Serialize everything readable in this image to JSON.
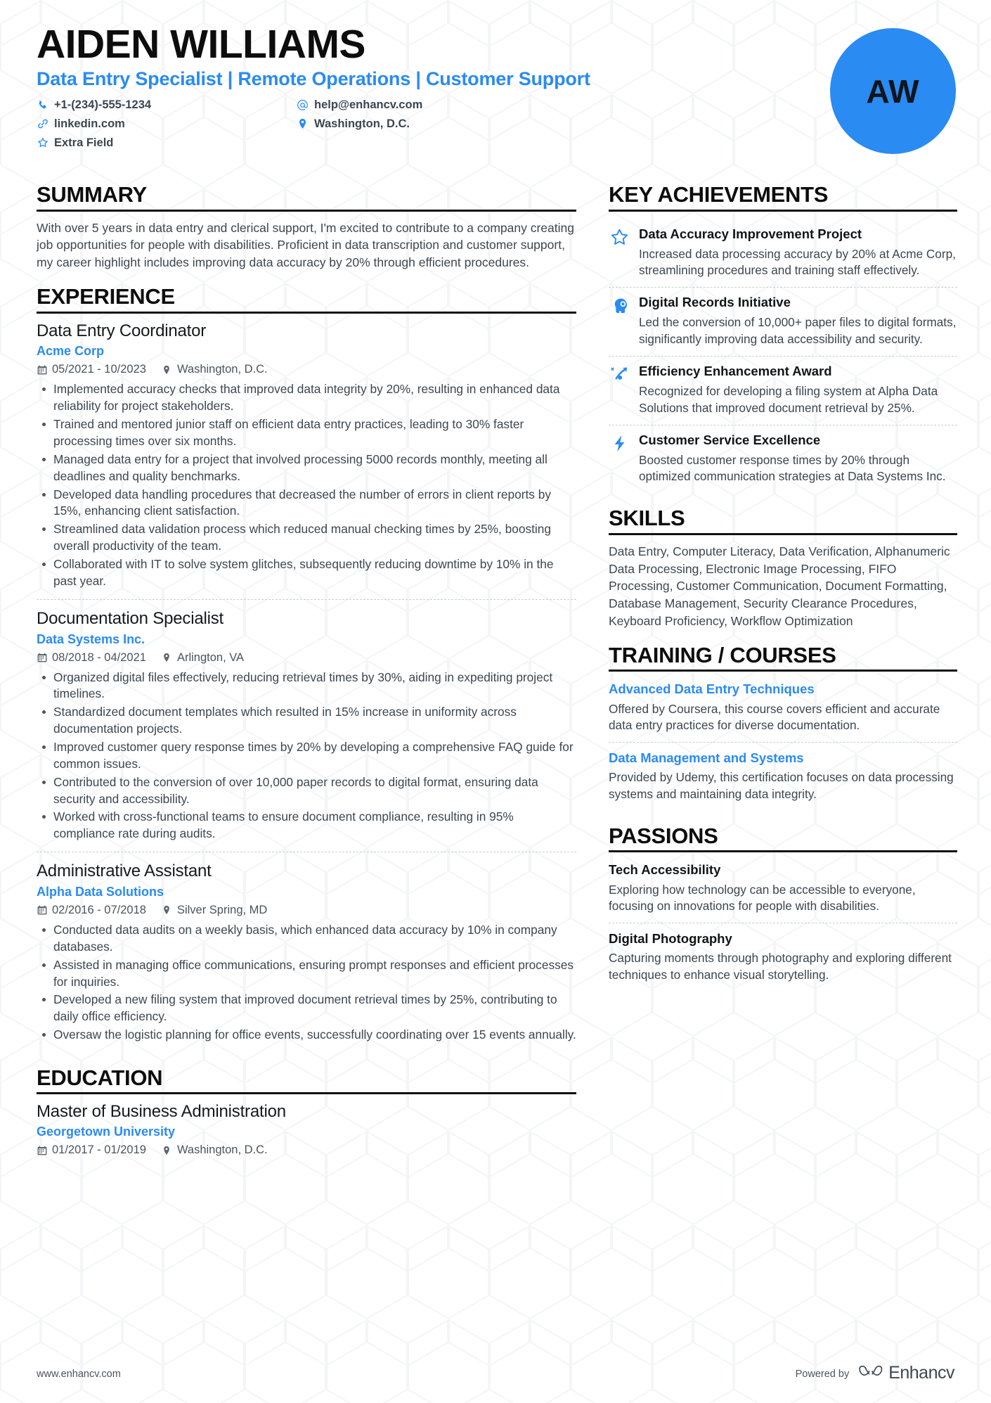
{
  "header": {
    "name": "AIDEN WILLIAMS",
    "headline": "Data Entry Specialist | Remote Operations | Customer Support",
    "avatar_initials": "AW",
    "accent_color": "#2a8bf2",
    "contacts": [
      {
        "icon": "phone-icon",
        "value": "+1-(234)-555-1234"
      },
      {
        "icon": "link-icon",
        "value": "linkedin.com"
      },
      {
        "icon": "star-icon",
        "value": "Extra Field"
      },
      {
        "icon": "at-icon",
        "value": "help@enhancv.com"
      },
      {
        "icon": "location-icon",
        "value": "Washington, D.C."
      }
    ]
  },
  "summary": {
    "title": "SUMMARY",
    "text": "With over 5 years in data entry and clerical support, I'm excited to contribute to a company creating job opportunities for people with disabilities. Proficient in data transcription and customer support, my career highlight includes improving data accuracy by 20% through efficient procedures."
  },
  "experience": {
    "title": "EXPERIENCE",
    "jobs": [
      {
        "role": "Data Entry Coordinator",
        "company": "Acme Corp",
        "dates": "05/2021 - 10/2023",
        "location": "Washington, D.C.",
        "bullets": [
          "Implemented accuracy checks that improved data integrity by 20%, resulting in enhanced data reliability for project stakeholders.",
          "Trained and mentored junior staff on efficient data entry practices, leading to 30% faster processing times over six months.",
          "Managed data entry for a project that involved processing 5000 records monthly, meeting all deadlines and quality benchmarks.",
          "Developed data handling procedures that decreased the number of errors in client reports by 15%, enhancing client satisfaction.",
          "Streamlined data validation process which reduced manual checking times by 25%, boosting overall productivity of the team.",
          "Collaborated with IT to solve system glitches, subsequently reducing downtime by 10% in the past year."
        ]
      },
      {
        "role": "Documentation Specialist",
        "company": "Data Systems Inc.",
        "dates": "08/2018 - 04/2021",
        "location": "Arlington, VA",
        "bullets": [
          "Organized digital files effectively, reducing retrieval times by 30%, aiding in expediting project timelines.",
          "Standardized document templates which resulted in 15% increase in uniformity across documentation projects.",
          "Improved customer query response times by 20% by developing a comprehensive FAQ guide for common issues.",
          "Contributed to the conversion of over 10,000 paper records to digital format, ensuring data security and accessibility.",
          "Worked with cross-functional teams to ensure document compliance, resulting in 95% compliance rate during audits."
        ]
      },
      {
        "role": "Administrative Assistant",
        "company": "Alpha Data Solutions",
        "dates": "02/2016 - 07/2018",
        "location": "Silver Spring, MD",
        "bullets": [
          "Conducted data audits on a weekly basis, which enhanced data accuracy by 10% in company databases.",
          "Assisted in managing office communications, ensuring prompt responses and efficient processes for inquiries.",
          "Developed a new filing system that improved document retrieval times by 25%, contributing to daily office efficiency.",
          "Oversaw the logistic planning for office events, successfully coordinating over 15 events annually."
        ]
      }
    ]
  },
  "education": {
    "title": "EDUCATION",
    "entries": [
      {
        "degree": "Master of Business Administration",
        "school": "Georgetown University",
        "dates": "01/2017 - 01/2019",
        "location": "Washington, D.C."
      }
    ]
  },
  "key_achievements": {
    "title": "KEY ACHIEVEMENTS",
    "items": [
      {
        "icon": "star-icon",
        "title": "Data Accuracy Improvement Project",
        "description": "Increased data processing accuracy by 20% at Acme Corp, streamlining procedures and training staff effectively."
      },
      {
        "icon": "head-brain-icon",
        "title": "Digital Records Initiative",
        "description": "Led the conversion of 10,000+ paper files to digital formats, significantly improving data accessibility and security."
      },
      {
        "icon": "trending-arrow-icon",
        "title": "Efficiency Enhancement Award",
        "description": "Recognized for developing a filing system at Alpha Data Solutions that improved document retrieval by 25%."
      },
      {
        "icon": "lightning-bolt-icon",
        "title": "Customer Service Excellence",
        "description": "Boosted customer response times by 20% through optimized communication strategies at Data Systems Inc."
      }
    ]
  },
  "skills": {
    "title": "SKILLS",
    "text": "Data Entry, Computer Literacy, Data Verification, Alphanumeric Data Processing, Electronic Image Processing, FIFO Processing, Customer Communication, Document Formatting, Database Management, Security Clearance Procedures, Keyboard Proficiency, Workflow Optimization"
  },
  "training": {
    "title": "TRAINING / COURSES",
    "items": [
      {
        "name": "Advanced Data Entry Techniques",
        "description": "Offered by Coursera, this course covers efficient and accurate data entry practices for diverse documentation."
      },
      {
        "name": "Data Management and Systems",
        "description": "Provided by Udemy, this certification focuses on data processing systems and maintaining data integrity."
      }
    ]
  },
  "passions": {
    "title": "PASSIONS",
    "items": [
      {
        "name": "Tech Accessibility",
        "description": "Exploring how technology can be accessible to everyone, focusing on innovations for people with disabilities."
      },
      {
        "name": "Digital Photography",
        "description": "Capturing moments through photography and exploring different techniques to enhance visual storytelling."
      }
    ]
  },
  "footer": {
    "url": "www.enhancv.com",
    "powered_by": "Powered by",
    "brand": "Enhancv"
  }
}
